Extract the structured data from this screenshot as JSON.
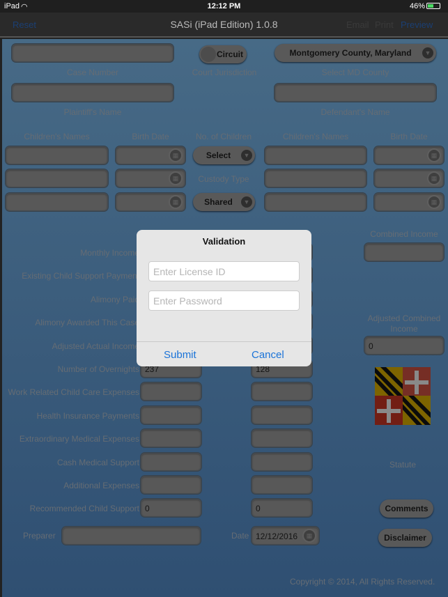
{
  "status": {
    "device": "iPad",
    "time": "12:12 PM",
    "battery": "46%"
  },
  "nav": {
    "title": "SASi (iPad Edition) 1.0.8",
    "reset": "Reset",
    "email": "Email",
    "print": "Print",
    "preview": "Preview"
  },
  "header": {
    "case_number_label": "Case Number",
    "jurisdiction_label": "Court Jurisdiction",
    "jurisdiction_value": "Circuit",
    "county_label": "Select MD County",
    "county_value": "Montgomery County, Maryland",
    "plaintiff_label": "Plaintiff's Name",
    "defendant_label": "Defendant's Name"
  },
  "children": {
    "names_label": "Children's Names",
    "birth_label": "Birth Date",
    "count_label": "No. of Children",
    "count_value": "Select",
    "custody_label": "Custody Type",
    "custody_value": "Shared"
  },
  "income": {
    "combined_label": "Combined Income",
    "adjusted_combined_label": "Adjusted Combined Income",
    "adjusted_combined_value": "0",
    "rows": [
      {
        "label": "Monthly Income",
        "left": "",
        "right": ""
      },
      {
        "label": "Existing Child Support Payment",
        "left": "",
        "right": ""
      },
      {
        "label": "Alimony Paid",
        "left": "",
        "right": ""
      },
      {
        "label": "Alimony Awarded This Case",
        "left": "",
        "right": ""
      },
      {
        "label": "Adjusted Actual Income",
        "left": "",
        "right": "0"
      },
      {
        "label": "Number of Overnights",
        "left": "237",
        "right": "128"
      },
      {
        "label": "Work Related Child Care Expenses",
        "left": "",
        "right": ""
      },
      {
        "label": "Health Insurance Payments",
        "left": "",
        "right": ""
      },
      {
        "label": "Extraordinary Medical Expenses",
        "left": "",
        "right": ""
      },
      {
        "label": "Cash Medical Support",
        "left": "",
        "right": ""
      },
      {
        "label": "Additional Expenses",
        "left": "",
        "right": ""
      },
      {
        "label": "Recommended Child Support",
        "left": "0",
        "right": "0"
      }
    ]
  },
  "footer": {
    "preparer_label": "Preparer",
    "date_label": "Date",
    "date_value": "12/12/2016",
    "statute_label": "Statute",
    "comments": "Comments",
    "disclaimer": "Disclaimer",
    "copyright": "Copyright © 2014, All Rights Reserved."
  },
  "dialog": {
    "title": "Validation",
    "license_placeholder": "Enter License ID",
    "password_placeholder": "Enter Password",
    "submit": "Submit",
    "cancel": "Cancel"
  },
  "colors": {
    "accent": "#1a73d8",
    "background": "#3b5f80"
  }
}
